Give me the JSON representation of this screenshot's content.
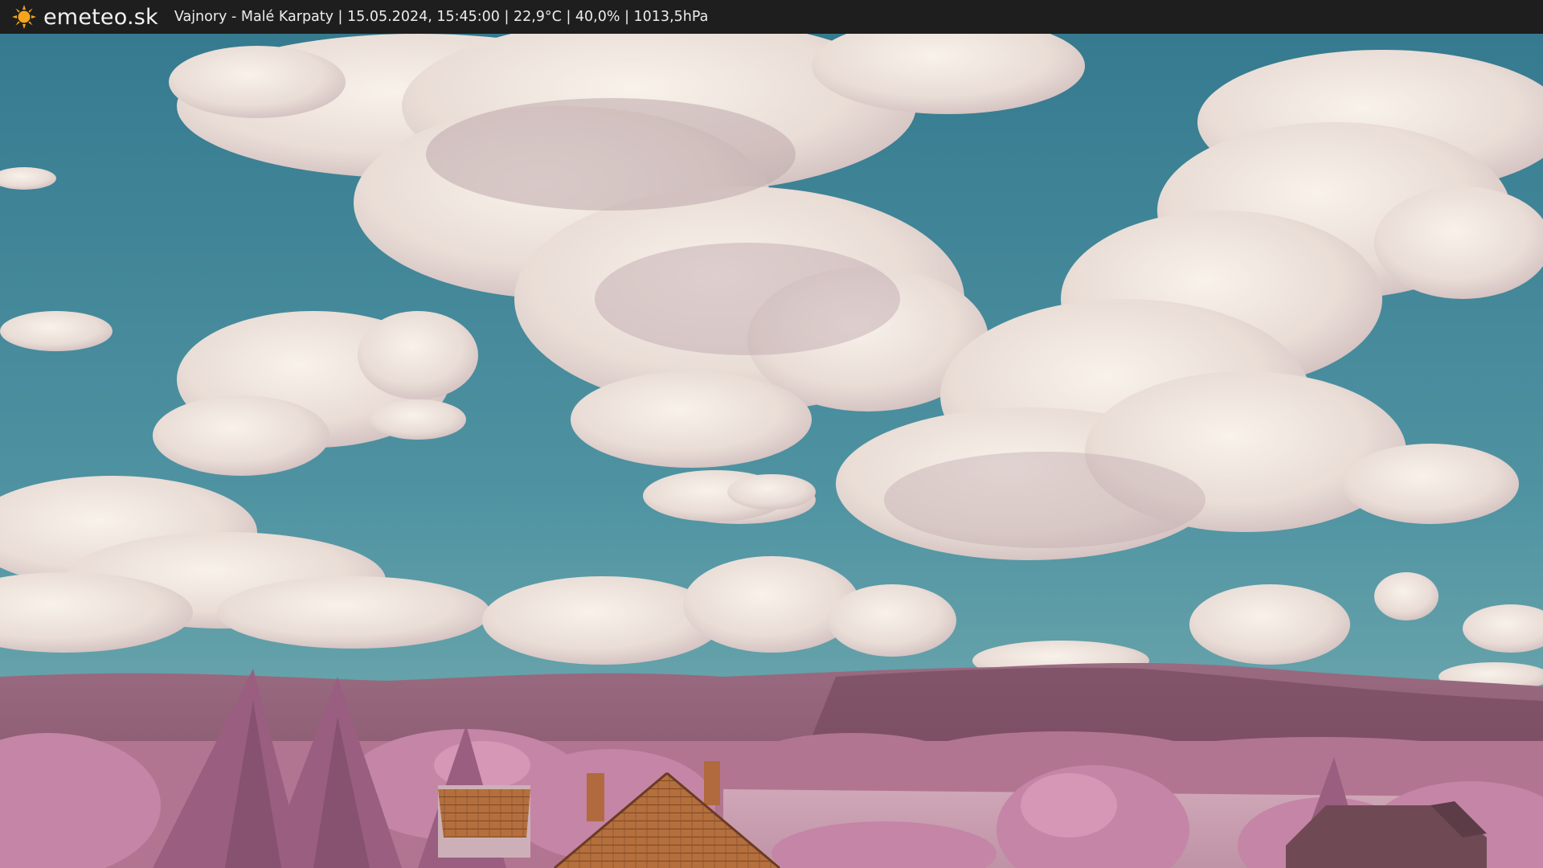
{
  "header": {
    "brand": "emeteo.sk",
    "caption": "Vajnory - Malé Karpaty | 15.05.2024, 15:45:00 | 22,9°C | 40,0% | 1013,5hPa"
  },
  "icons": {
    "logo": "sun-icon"
  },
  "colors": {
    "bar": "#1e1e1e",
    "sun": "#f4a51c",
    "sky_top": "#3a7f93",
    "sky_bottom": "#6aa7ad",
    "cloud": "#f3ece6",
    "hills": "#8c5a72",
    "foliage": "#c07aa0",
    "roof": "#b4703e"
  }
}
